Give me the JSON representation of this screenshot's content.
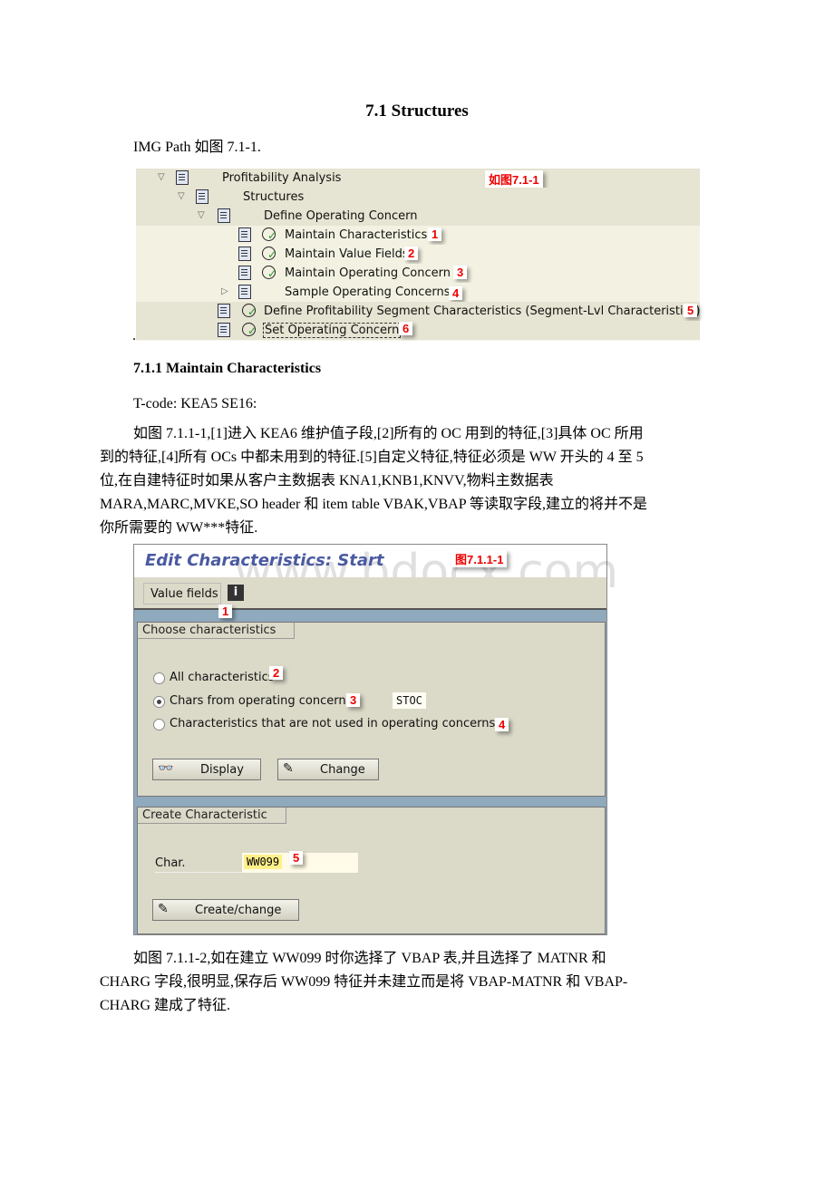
{
  "heading": "7.1 Structures",
  "img_path_text": "IMG Path 如图 7.1-1.",
  "tree_figure": {
    "caption": "如图7.1-1",
    "rows": [
      {
        "label": "Profitability Analysis"
      },
      {
        "label": "Structures"
      },
      {
        "label": "Define Operating Concern"
      },
      {
        "label": "Maintain Characteristics",
        "badge": "1"
      },
      {
        "label": "Maintain Value Fields",
        "badge": "2"
      },
      {
        "label": "Maintain Operating Concern",
        "badge": "3"
      },
      {
        "label": "Sample Operating Concerns",
        "badge": "4"
      },
      {
        "label": "Define Profitability Segment Characteristics (Segment-Lvl Characteristics)",
        "badge": "5"
      },
      {
        "label": "Set Operating Concern",
        "badge": "6"
      }
    ]
  },
  "stray_dot": ".",
  "section": {
    "title": "7.1.1 Maintain Characteristics",
    "tcode": "T-code: KEA5 SE16:",
    "para1": [
      "如图 7.1.1-1,[1]进入 KEA6 维护值子段,[2]所有的 OC 用到的特征,[3]具体 OC 所用",
      "到的特征,[4]所有 OCs 中都未用到的特征.[5]自定义特征,特征必须是 WW 开头的 4 至 5",
      "位,在自建特征时如果从客户主数据表 KNA1,KNB1,KNVV,物料主数据表",
      "MARA,MARC,MVKE,SO header 和 item table VBAK,VBAP 等读取字段,建立的将并不是",
      "你所需要的 WW***特征."
    ],
    "para2": [
      "如图 7.1.1-2,如在建立 WW099 时你选择了 VBAP 表,并且选择了 MATNR 和",
      "CHARG 字段,很明显,保存后 WW099 特征并未建立而是将 VBAP-MATNR 和 VBAP-",
      "CHARG 建成了特征."
    ]
  },
  "sap_figure": {
    "title": "Edit Characteristics: Start",
    "caption": "图7.1.1-1",
    "watermark": "www.bdocx.com",
    "toolbar": {
      "value_fields": "Value fields",
      "info_icon": "info-icon",
      "badge": "1"
    },
    "choose_group": {
      "title": "Choose characteristics",
      "options": [
        {
          "label": "All characteristics",
          "badge": "2",
          "selected": false
        },
        {
          "label": "Chars from operating concern",
          "badge": "3",
          "selected": true,
          "value": "STOC"
        },
        {
          "label": "Characteristics that are not used in operating concerns",
          "badge": "4",
          "selected": false
        }
      ],
      "display_button": "Display",
      "change_button": "Change"
    },
    "create_group": {
      "title": "Create Characteristic",
      "char_label": "Char.",
      "char_value": "WW099",
      "badge": "5",
      "create_button": "Create/change"
    }
  },
  "colors": {
    "badge_text": "#ee0000",
    "sap_title": "#4a5aa0",
    "sap_band": "#8fa9bd",
    "field_highlight": "#fff08a"
  }
}
